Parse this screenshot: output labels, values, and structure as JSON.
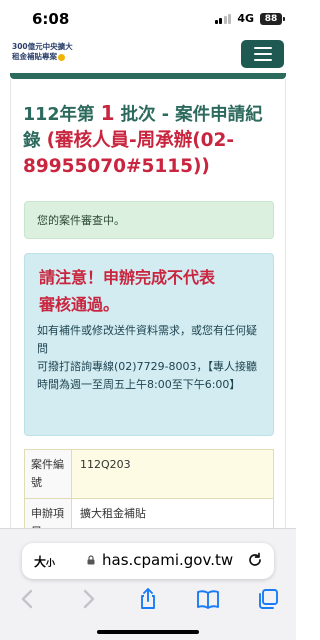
{
  "status_bar": {
    "time": "6:08",
    "network": "4G",
    "battery": "88"
  },
  "site": {
    "logo_line1": "300億元中央擴大",
    "logo_line2": "租金補貼專案"
  },
  "page": {
    "title_prefix": "112年第",
    "title_batch": "1",
    "title_suffix": "批次 - 案件申請紀錄",
    "title_contact": "(審核人員-周承辦(02-89955070#5115))"
  },
  "status_notice": "您的案件審查中。",
  "info": {
    "warning_line1": "請注意！申辦完成不代表",
    "warning_line2": "審核通過。",
    "line1": "如有補件或修改送件資料需求，或您有任何疑問",
    "line2": "可撥打諮詢專線(02)7729-8003，【專人接聽時間為週一至周五上午8:00至下午6:00】"
  },
  "table": {
    "rows": [
      {
        "label": "案件編號",
        "value": "112Q203"
      },
      {
        "label": "申辦項目",
        "value": "擴大租金補貼"
      }
    ]
  },
  "browser": {
    "text_size_label": "大",
    "text_size_small": "小",
    "url": "has.cpami.gov.tw"
  },
  "icons": {
    "back": "chevron-left-icon",
    "forward": "chevron-right-icon",
    "share": "share-icon",
    "bookmarks": "book-icon",
    "tabs": "tabs-icon"
  },
  "colors": {
    "brand_green": "#2d6a5e",
    "accent_red": "#c9253f",
    "info_bg": "#d2ecf1",
    "notice_bg": "#dcf0e0"
  }
}
